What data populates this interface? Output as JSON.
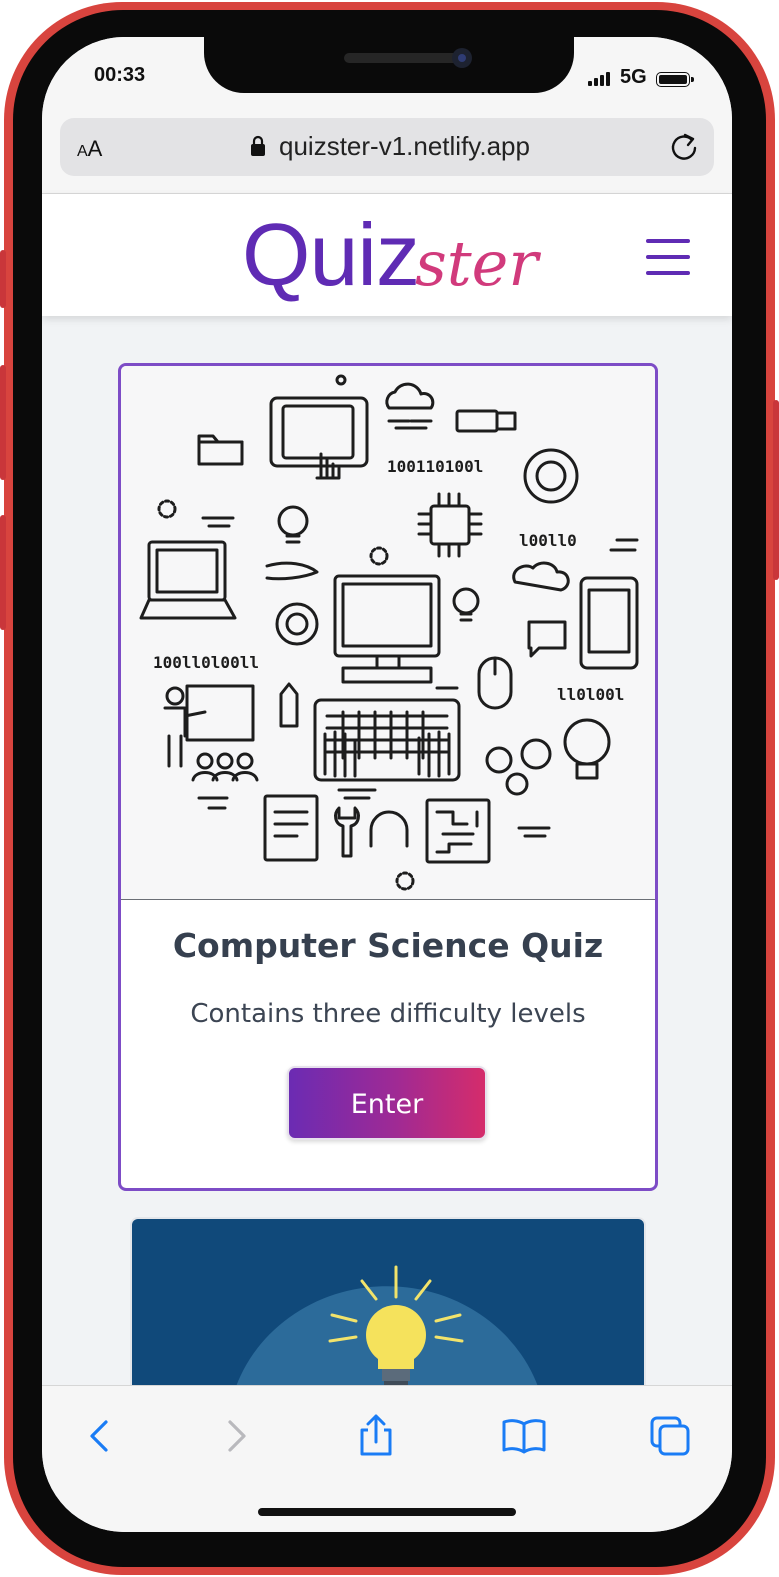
{
  "status_bar": {
    "time": "00:33",
    "network": "5G"
  },
  "browser": {
    "text_size_label_small": "A",
    "text_size_label_large": "A",
    "url": "quizster-v1.netlify.app"
  },
  "header": {
    "logo_primary": "Quiz",
    "logo_secondary": "ster"
  },
  "quiz_card": {
    "title": "Computer Science Quiz",
    "subtitle": "Contains three difficulty levels",
    "button_label": "Enter"
  },
  "colors": {
    "brand_purple": "#5f2bb4",
    "brand_pink": "#d13a7c",
    "ios_blue": "#1a7cf5",
    "phone_red": "#d8443e"
  },
  "toolbar": {
    "icons": [
      "back-icon",
      "forward-icon",
      "share-icon",
      "bookmarks-icon",
      "tabs-icon"
    ]
  }
}
